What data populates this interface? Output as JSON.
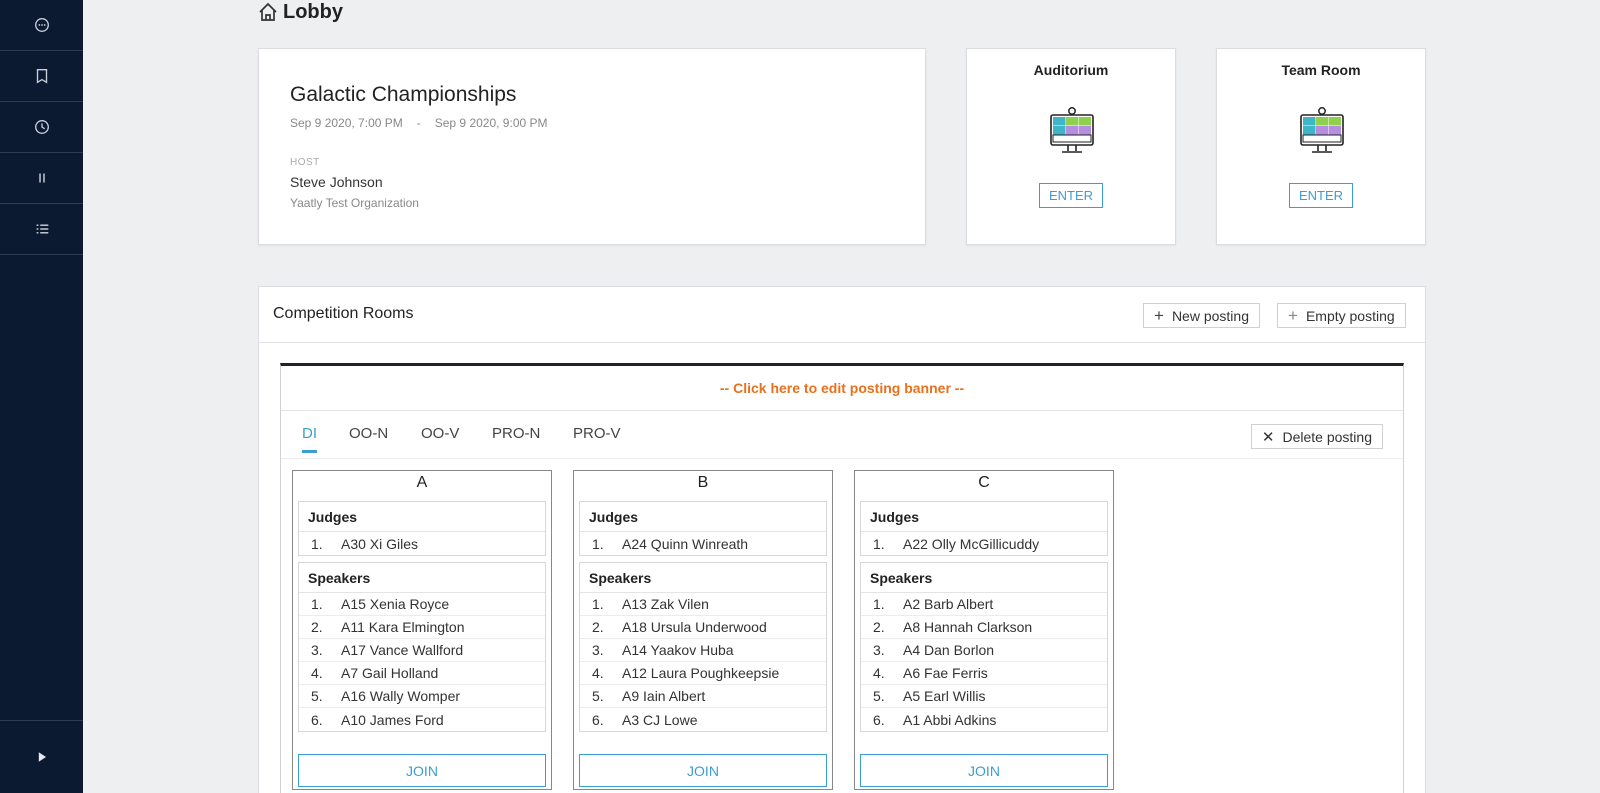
{
  "sidebar": {
    "items": [
      {
        "icon": "chat-bubble-icon"
      },
      {
        "icon": "bookmark-icon"
      },
      {
        "icon": "clock-icon"
      },
      {
        "icon": "pause-icon"
      },
      {
        "icon": "list-icon"
      }
    ],
    "bottom_icon": "play-icon"
  },
  "header": {
    "title": "Lobby",
    "icon": "home-icon"
  },
  "event": {
    "name": "Galactic Championships",
    "start": "Sep 9 2020, 7:00 PM",
    "separator": "-",
    "end": "Sep 9 2020, 9:00 PM",
    "host_label": "HOST",
    "host_name": "Steve Johnson",
    "host_org": "Yaatly Test Organization"
  },
  "rooms": [
    {
      "title": "Auditorium",
      "button": "ENTER",
      "icon": "video-conference-icon"
    },
    {
      "title": "Team Room",
      "button": "ENTER",
      "icon": "video-conference-icon"
    }
  ],
  "competition": {
    "title": "Competition Rooms",
    "new_posting": "New posting",
    "empty_posting": "Empty posting",
    "banner": "-- Click here to edit posting banner --",
    "delete_posting": "Delete posting",
    "tabs": [
      "DI",
      "OO-N",
      "OO-V",
      "PRO-N",
      "PRO-V"
    ],
    "active_tab": "DI",
    "judges_label": "Judges",
    "speakers_label": "Speakers",
    "join_label": "JOIN",
    "columns": [
      {
        "name": "A",
        "judges": [
          "A30 Xi Giles"
        ],
        "speakers": [
          "A15 Xenia Royce",
          "A11 Kara Elmington",
          "A17 Vance Wallford",
          "A7 Gail Holland",
          "A16 Wally Womper",
          "A10 James Ford"
        ]
      },
      {
        "name": "B",
        "judges": [
          "A24 Quinn Winreath"
        ],
        "speakers": [
          "A13 Zak Vilen",
          "A18 Ursula Underwood",
          "A14 Yaakov Huba",
          "A12 Laura Poughkeepsie",
          "A9 Iain Albert",
          "A3 CJ Lowe"
        ]
      },
      {
        "name": "C",
        "judges": [
          "A22 Olly McGillicuddy"
        ],
        "speakers": [
          "A2 Barb Albert",
          "A8 Hannah Clarkson",
          "A4 Dan Borlon",
          "A6 Fae Ferris",
          "A5 Earl Willis",
          "A1 Abbi Adkins"
        ]
      }
    ]
  },
  "colors": {
    "sidebar": "#0c1a31",
    "accent": "#3a9ed3",
    "banner": "#e8711c"
  }
}
